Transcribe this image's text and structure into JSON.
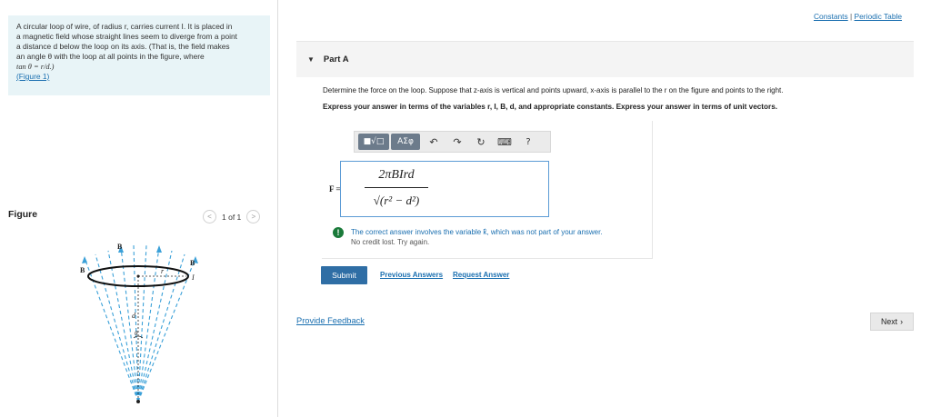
{
  "problem": {
    "line1": "A circular loop of wire, of radius r, carries current I. It is placed in",
    "line2": "a magnetic field whose straight lines seem to diverge from a point",
    "line3": "a distance d below the loop on its axis. (That is, the field makes",
    "line4": "an angle θ with the loop at all points in the figure, where",
    "line5": "tan θ = r/d.)",
    "figure_link": "(Figure 1)"
  },
  "figure": {
    "label": "Figure",
    "pager_text": "1 of 1",
    "prev_icon": "chevron-left-icon",
    "next_icon": "chevron-right-icon",
    "labels": {
      "b_top": "B",
      "b_left": "B",
      "b_right": "B",
      "r": "r",
      "i": "I",
      "d": "d",
      "theta": "θ"
    },
    "colors": {
      "field_lines": "#3aa0d8",
      "loop": "#111111"
    }
  },
  "top_links": {
    "constants": "Constants",
    "separator": "|",
    "periodic_table": "Periodic Table"
  },
  "part": {
    "caret": "▼",
    "title": "Part A"
  },
  "question": {
    "text": "Determine the force on the loop. Suppose that z-axis is vertical and points upward, x-axis is parallel to the r on the figure and points to the right.",
    "instruction": "Express your answer in terms of the variables r, I, B, d, and appropriate constants. Express your answer in terms of unit vectors."
  },
  "toolbar": {
    "templates": "■√□",
    "symbols": "ΑΣφ",
    "undo": "↶",
    "redo": "↷",
    "reset": "↻",
    "keyboard": "⌨",
    "help": "?"
  },
  "answer": {
    "label": "F =",
    "numerator": "2πBIrd",
    "denominator": "√(r² − d²)"
  },
  "feedback": {
    "icon": "!",
    "line1": "The correct answer involves the variable k̂, which was not part of your answer.",
    "line2": "No credit lost. Try again."
  },
  "actions": {
    "submit": "Submit",
    "previous_answers": "Previous Answers",
    "request_answer": "Request Answer",
    "provide_feedback": "Provide Feedback",
    "next": "Next",
    "next_icon": "›"
  }
}
